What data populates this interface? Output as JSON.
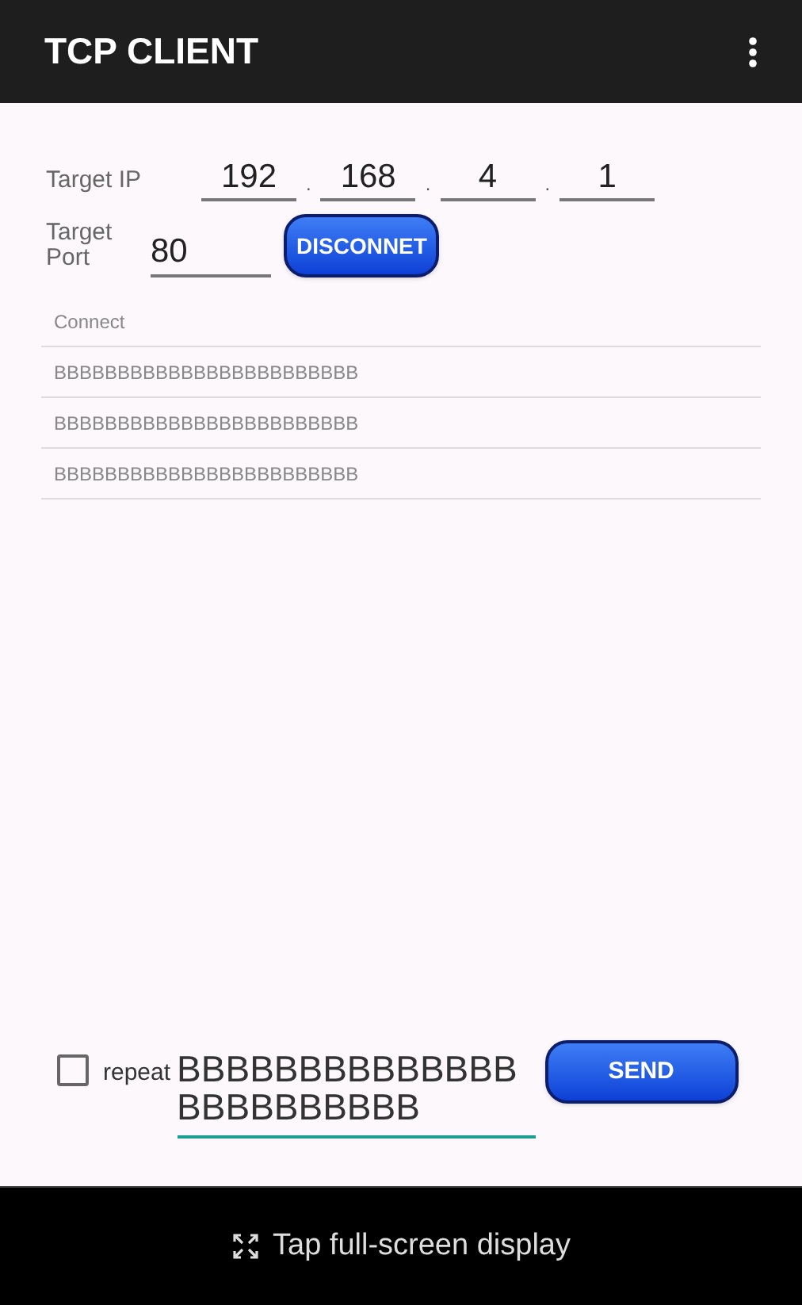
{
  "app_bar": {
    "title": "TCP CLIENT"
  },
  "target_ip": {
    "label": "Target IP",
    "octets": [
      "192",
      "168",
      "4",
      "1"
    ],
    "separator": "."
  },
  "target_port": {
    "label": "Target\nPort",
    "value": "80",
    "button": "DISCONNET"
  },
  "log": [
    "Connect",
    "BBBBBBBBBBBBBBBBBBBBBBBB",
    "BBBBBBBBBBBBBBBBBBBBBBBB",
    "BBBBBBBBBBBBBBBBBBBBBBBB"
  ],
  "send_bar": {
    "repeat": {
      "label": "repeat",
      "checked": false
    },
    "message": "BBBBBBBBBBBBBBBBBBBBBBBB",
    "button": "SEND"
  },
  "bottom_bar": {
    "text": "Tap full-screen display"
  }
}
